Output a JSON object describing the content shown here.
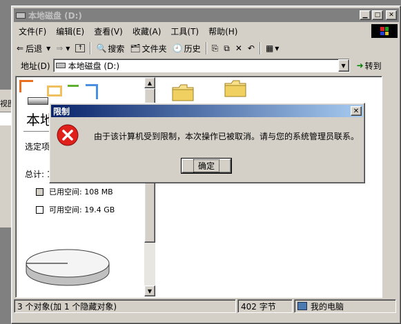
{
  "window": {
    "title": "本地磁盘 (D:)",
    "menu": [
      "文件(F)",
      "编辑(E)",
      "查看(V)",
      "收藏(A)",
      "工具(T)",
      "帮助(H)"
    ],
    "toolbar": {
      "back": "后退",
      "search": "搜索",
      "folders": "文件夹",
      "history": "历史"
    },
    "address": {
      "label": "地址(D)",
      "value": "本地磁盘 (D:)",
      "go": "转到"
    }
  },
  "left_panel": {
    "title": "本地",
    "select_hint": "选定项",
    "total": "总计: 1",
    "used_label": "已用空间: 108 MB",
    "free_label": "可用空间: 19.4 GB",
    "used_fraction": 0.005
  },
  "folders": [
    {
      "name": ""
    },
    {
      "name": ""
    }
  ],
  "status": {
    "objects": "3 个对象(加 1 个隐藏对象)",
    "size": "402 字节",
    "location": "我的电脑"
  },
  "background_window": {
    "fragment": "视图"
  },
  "dialog": {
    "title": "限制",
    "message": "由于该计算机受到限制，本次操作已被取消。请与您的系统管理员联系。",
    "ok": "确定"
  },
  "colors": {
    "dialog_title_start": "#0a246a",
    "dialog_title_end": "#a6caf0",
    "error_icon": "#e0201a",
    "face": "#d4d0c8"
  }
}
